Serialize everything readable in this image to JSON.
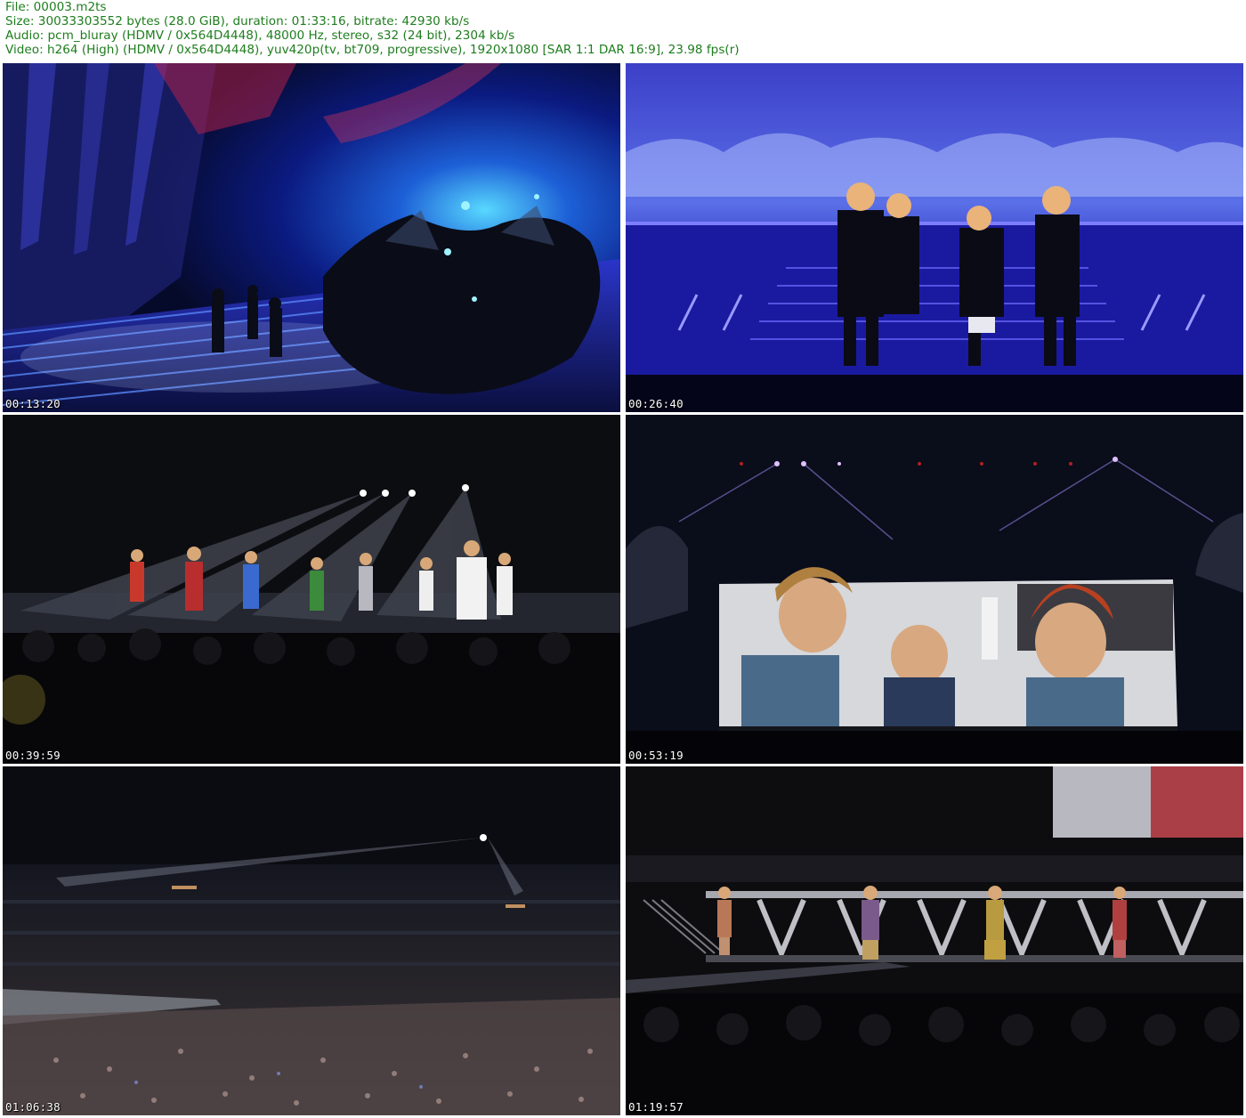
{
  "header": {
    "file": "File: 00003.m2ts",
    "size": "Size: 30033303552 bytes (28.0 GiB), duration: 01:33:16, bitrate: 42930 kb/s",
    "audio": "Audio: pcm_bluray (HDMV / 0x564D4448), 48000 Hz, stereo, s32 (24 bit), 2304 kb/s",
    "video": "Video: h264 (High) (HDMV / 0x564D4448), yuv420p(tv, bt709, progressive), 1920x1080 [SAR 1:1 DAR 16:9], 23.98 fps(r)"
  },
  "colors": {
    "header_text": "#1e7d1e",
    "timestamp_text": "#ffffff"
  },
  "thumbnails": [
    {
      "timestamp": "00:13:20",
      "scene": "blue-stage-staircase-with-costumed-dancers"
    },
    {
      "timestamp": "00:26:40",
      "scene": "performers-in-sequin-jackets-facing-led-screen"
    },
    {
      "timestamp": "00:39:59",
      "scene": "performers-on-stage-under-spotlights"
    },
    {
      "timestamp": "00:53:19",
      "scene": "large-screen-showing-close-up-of-performers"
    },
    {
      "timestamp": "01:06:38",
      "scene": "wide-stadium-view-with-crowd"
    },
    {
      "timestamp": "01:19:57",
      "scene": "four-performers-on-lit-stage-platform"
    }
  ]
}
